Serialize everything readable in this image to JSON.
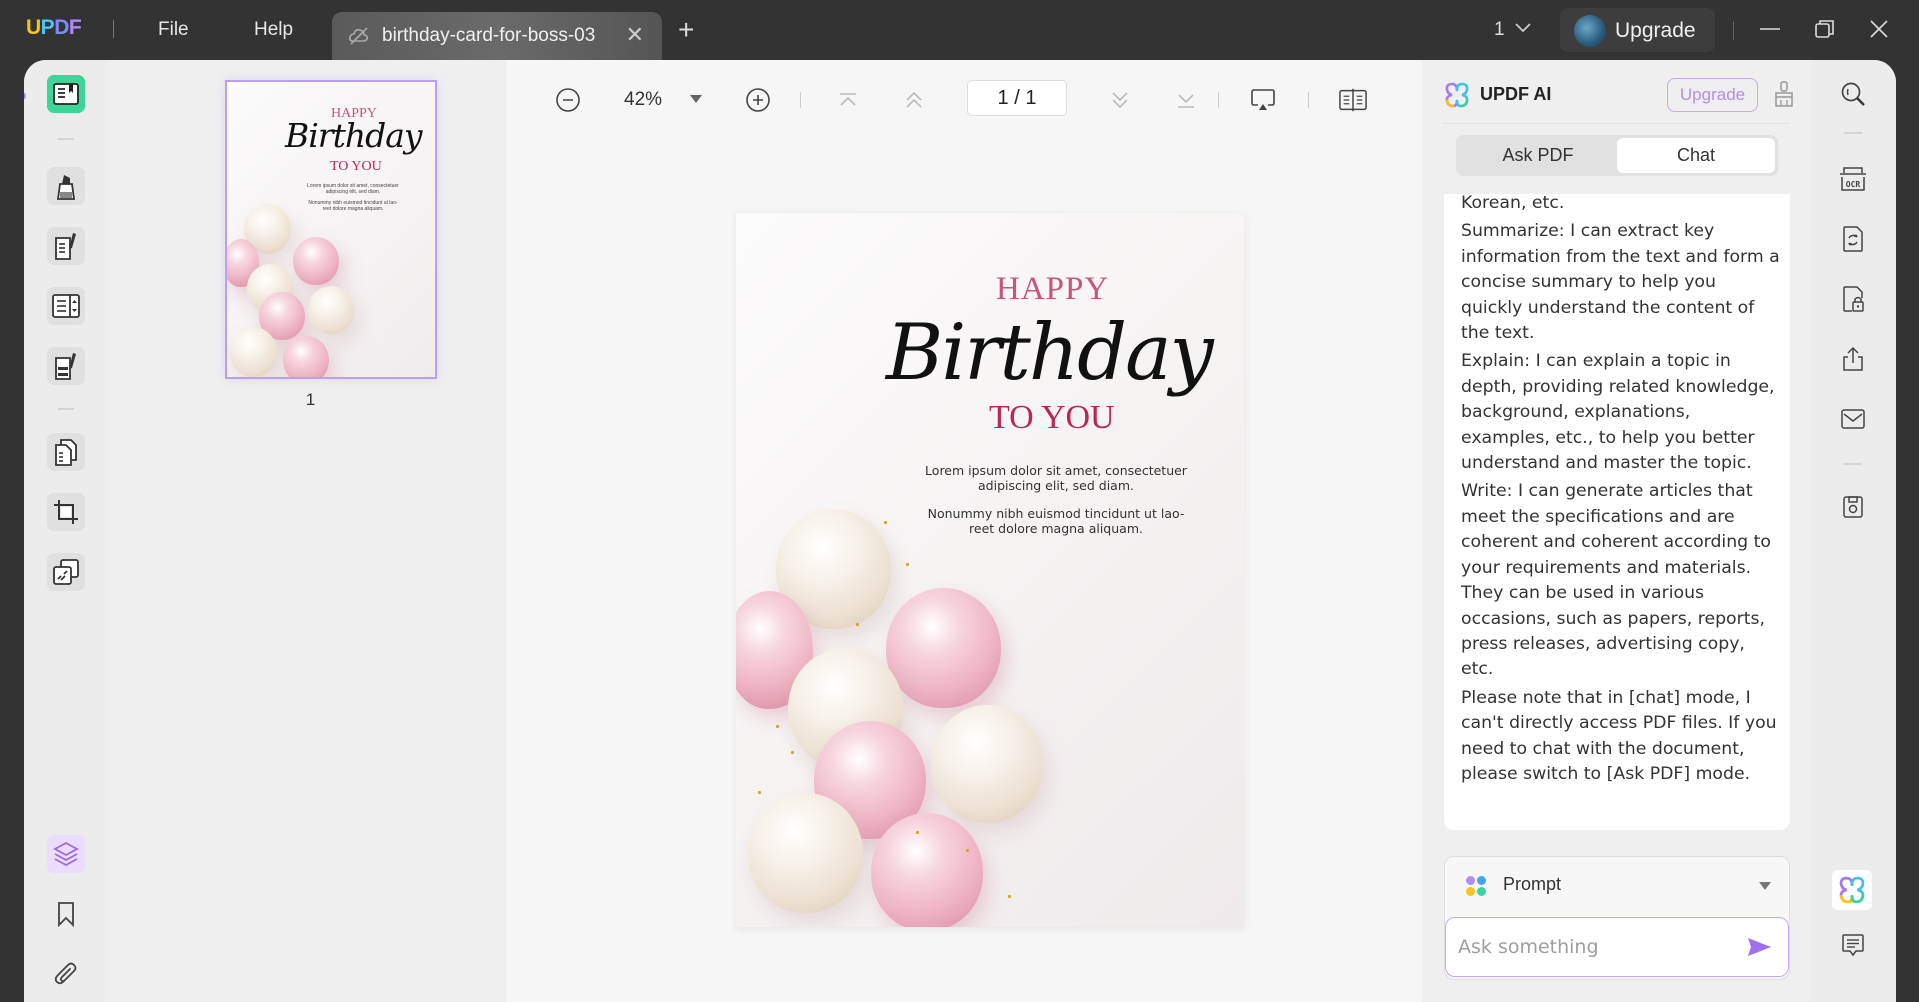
{
  "app": {
    "logo": [
      "U",
      "P",
      "D",
      "F"
    ],
    "menu": {
      "file": "File",
      "help": "Help"
    },
    "tab": {
      "title": "birthday-card-for-boss-03"
    },
    "page_selector": "1",
    "upgrade_label": "Upgrade"
  },
  "left_rail": {
    "items": [
      {
        "name": "reader",
        "active": true
      },
      {
        "name": "comment"
      },
      {
        "name": "edit-pdf"
      },
      {
        "name": "form"
      },
      {
        "name": "fill-sign"
      },
      {
        "name": "organize-pages"
      },
      {
        "name": "crop"
      },
      {
        "name": "watermark"
      }
    ],
    "bottom": [
      "layers",
      "bookmark",
      "attachment"
    ]
  },
  "thumbnails": {
    "pages": [
      {
        "number": "1"
      }
    ]
  },
  "toolbar": {
    "zoom": "42%",
    "page_current": "1",
    "page_separator": "/",
    "page_total": "1"
  },
  "document": {
    "happy": "HAPPY",
    "birthday": "Birthday",
    "to_you": "TO YOU",
    "para1_line1": "Lorem ipsum dolor sit amet, consectetuer",
    "para1_line2": "adipiscing elit, sed diam.",
    "para2_line1": "Nonummy nibh euismod tincidunt ut lao-",
    "para2_line2": "reet dolore magna aliquam.",
    "colors": {
      "happy": "#c8567a",
      "to_you": "#b8285a"
    }
  },
  "ai_panel": {
    "title": "UPDF AI",
    "upgrade_label": "Upgrade",
    "tabs": [
      {
        "label": "Ask PDF",
        "active": false
      },
      {
        "label": "Chat",
        "active": true
      }
    ],
    "messages": [
      "Korean, etc.",
      "Summarize: I can extract key information from the text and form a concise summary to help you quickly understand the content of the text.",
      "Explain: I can explain a topic in depth, providing related knowledge, background, explanations, examples, etc., to help you better understand and master the topic.",
      "Write: I can generate articles that meet the specifications and are coherent and coherent according to your requirements and materials. They can be used in various occasions, such as papers, reports, press releases, advertising copy, etc.",
      "Please note that in [chat] mode, I can't directly access PDF files. If you need to chat with the document, please switch to [Ask PDF] mode."
    ],
    "prompt_label": "Prompt",
    "input": {
      "placeholder": "Ask something",
      "value": ""
    },
    "accent": "#a070f0"
  },
  "right_rail": {
    "items": [
      "search",
      "ocr",
      "convert",
      "protect",
      "share",
      "email",
      "save"
    ],
    "bottom": [
      "updf-ai",
      "comments"
    ]
  }
}
